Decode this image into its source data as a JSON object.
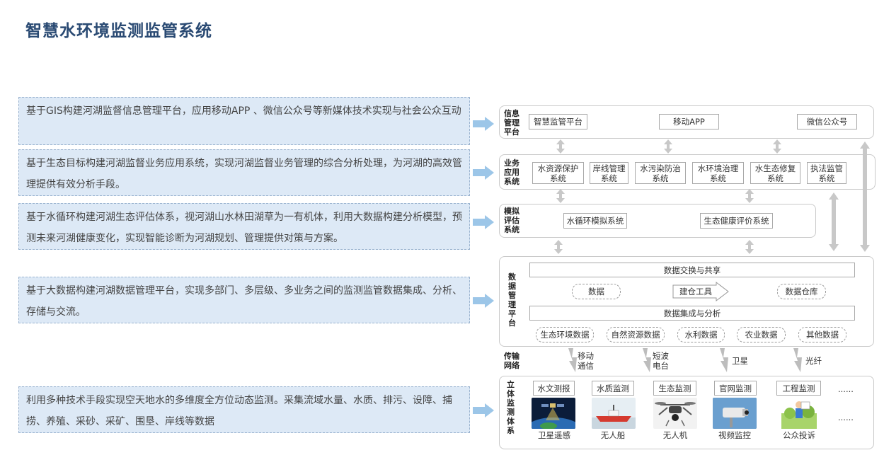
{
  "title": "智慧水环境监测监管系统",
  "descriptions": [
    "基于GIS构建河湖监督信息管理平台，应用移动APP 、微信公众号等新媒体技术实现与社会公众互动",
    "基于生态目标构建河湖监督业务应用系统，实现河湖监督业务管理的综合分析处理，为河湖的高效管理提供有效分析手段。",
    "基于水循环构建河湖生态评估体系，视河湖山水林田湖草为一有机体，利用大数据构建分析模型，预测未来河湖健康变化，实现智能诊断为河湖规划、管理提供对策与方案。",
    "基于大数据构建河湖数据管理平台，实现多部门、多层级、多业务之间的监测监管数据集成、分析、存储与交流。",
    "利用多种技术手段实现空天地水的多维度全方位动态监测。采集流域水量、水质、排污、设障、捕捞、养殖、采砂、采矿、围垦、岸线等数据"
  ],
  "info_platform": {
    "label": "信息\n管理\n平台",
    "items": [
      "智慧监管平台",
      "移动APP",
      "微信公众号"
    ]
  },
  "business_system": {
    "label": "业务\n应用\n系统",
    "items": [
      "水资源保护\n系统",
      "岸线管理\n系统",
      "水污染防治\n系统",
      "水环境治理\n系统",
      "水生态修复\n系统",
      "执法监管\n系统"
    ]
  },
  "simulation": {
    "label": "模拟\n评估\n系统",
    "items": [
      "水循环模拟系统",
      "生态健康评价系统"
    ]
  },
  "data_platform": {
    "label": "数\n据\n管\n理\n平\n台",
    "exchange": "数据交换与共享",
    "data": "数据",
    "tool": "建仓工具",
    "warehouse": "数据仓库",
    "integration": "数据集成与分析",
    "sources": [
      "生态环境数据",
      "自然资源数据",
      "水利数据",
      "农业数据",
      "其他数据"
    ]
  },
  "transmission": {
    "label": "传输\n网络",
    "items": [
      "移动\n通信",
      "短波\n电台",
      "卫星",
      "光纤"
    ]
  },
  "monitoring": {
    "label": "立\n体\n监\n测\n体\n系",
    "categories": [
      "水文测报",
      "水质监测",
      "生态监测",
      "官网监测",
      "工程监测",
      "......"
    ],
    "devices": [
      "卫星遥感",
      "无人船",
      "无人机",
      "视频监控",
      "公众投诉",
      "......"
    ]
  },
  "colors": {
    "title": "#2a4a73",
    "desc_bg": "#dde9f6",
    "arrow": "#9cc6e8",
    "gray_arrow": "#c8c8c8"
  }
}
